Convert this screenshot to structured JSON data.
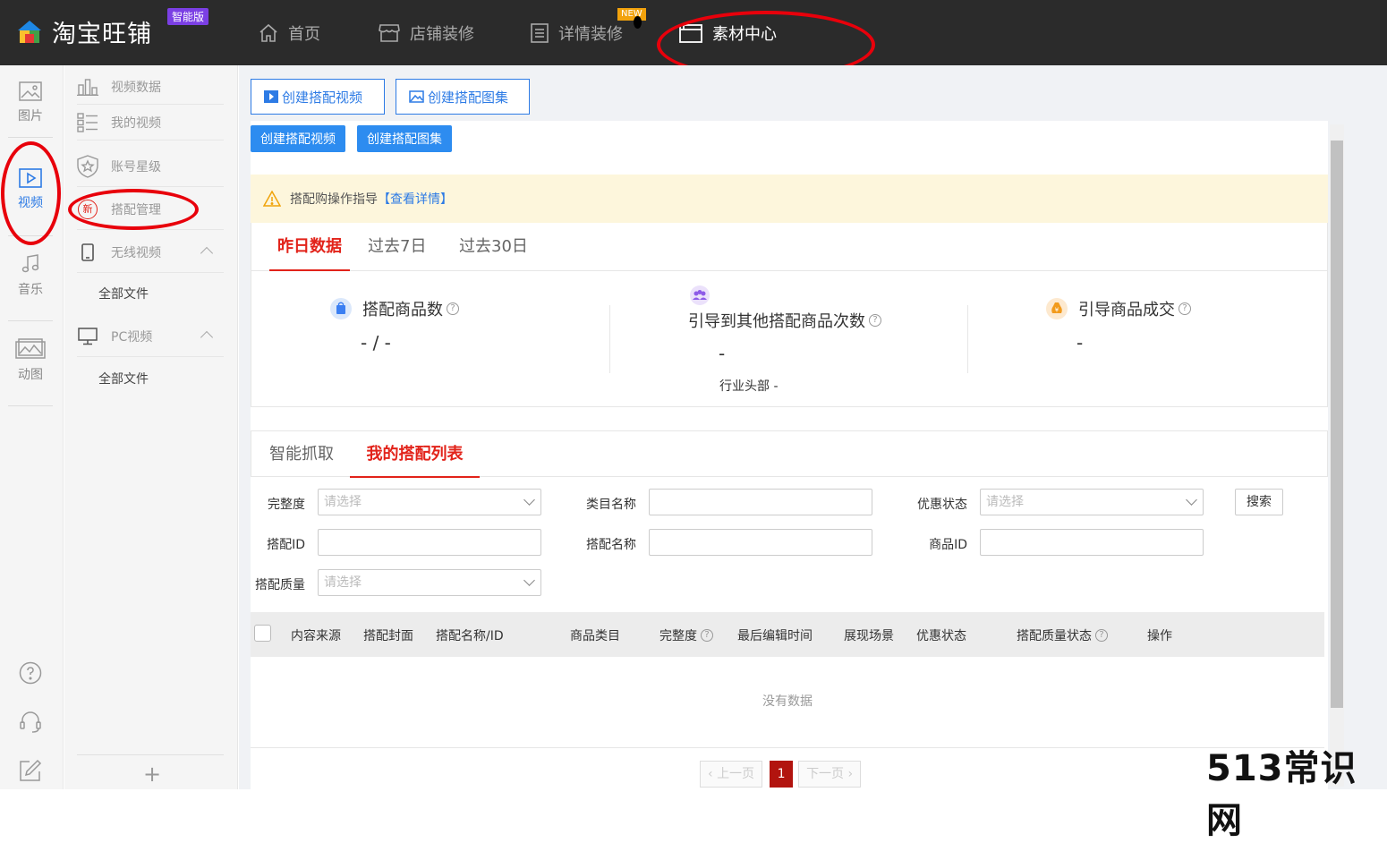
{
  "app": {
    "name": "淘宝旺铺",
    "edition": "智能版"
  },
  "topnav": [
    {
      "label": "首页",
      "icon": "home-icon"
    },
    {
      "label": "店铺装修",
      "icon": "store-icon"
    },
    {
      "label": "详情装修",
      "icon": "document-icon",
      "badge": "NEW"
    },
    {
      "label": "素材中心",
      "icon": "folder-icon",
      "active": true
    }
  ],
  "rail": [
    {
      "label": "图片",
      "icon": "image-icon"
    },
    {
      "label": "视频",
      "icon": "video-icon",
      "active": true
    },
    {
      "label": "音乐",
      "icon": "music-icon"
    },
    {
      "label": "动图",
      "icon": "gif-icon"
    }
  ],
  "subnav": {
    "items": [
      {
        "label": "视频数据",
        "icon": "bar-chart-icon"
      },
      {
        "label": "我的视频",
        "icon": "list-icon"
      },
      {
        "label": "账号星级",
        "icon": "star-shield-icon"
      },
      {
        "label": "搭配管理",
        "icon": "new-badge-icon",
        "icon_text": "新"
      },
      {
        "label": "无线视频",
        "icon": "mobile-icon"
      },
      {
        "label": "PC视频",
        "icon": "monitor-icon"
      }
    ],
    "children": {
      "wireless_all": "全部文件",
      "pc_all": "全部文件"
    },
    "add_symbol": "+"
  },
  "actions": {
    "create_video_outline": "创建搭配视频",
    "create_album_outline": "创建搭配图集",
    "create_video": "创建搭配视频",
    "create_album": "创建搭配图集"
  },
  "notice": {
    "text": "搭配购操作指导",
    "link": "【查看详情】"
  },
  "period_tabs": [
    "昨日数据",
    "过去7日",
    "过去30日"
  ],
  "stats": [
    {
      "title": "搭配商品数",
      "value": "- / -"
    },
    {
      "title": "引导到其他搭配商品次数",
      "value": "-",
      "sub": "行业头部 -"
    },
    {
      "title": "引导商品成交",
      "value": "-"
    }
  ],
  "list_tabs": [
    "智能抓取",
    "我的搭配列表"
  ],
  "filters": {
    "completeness": {
      "label": "完整度",
      "placeholder": "请选择"
    },
    "category": {
      "label": "类目名称",
      "value": ""
    },
    "discount": {
      "label": "优惠状态",
      "placeholder": "请选择"
    },
    "search_btn": "搜索",
    "match_id": {
      "label": "搭配ID",
      "value": ""
    },
    "match_name": {
      "label": "搭配名称",
      "value": ""
    },
    "product_id": {
      "label": "商品ID",
      "value": ""
    },
    "quality": {
      "label": "搭配质量",
      "placeholder": "请选择"
    }
  },
  "table": {
    "headers": [
      "内容来源",
      "搭配封面",
      "搭配名称/ID",
      "商品类目",
      "完整度",
      "最后编辑时间",
      "展现场景",
      "优惠状态",
      "搭配质量状态",
      "操作"
    ],
    "empty": "没有数据"
  },
  "pager": {
    "prev": "上一页",
    "current": "1",
    "next": "下一页"
  },
  "watermark": "513常识网"
}
